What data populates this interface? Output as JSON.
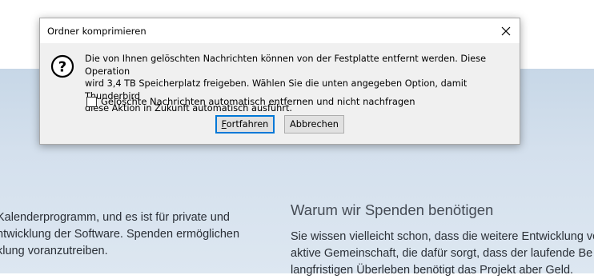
{
  "dialog": {
    "title": "Ordner komprimieren",
    "message_line1": "Die von Ihnen gelöschten Nachrichten können von der Festplatte entfernt werden. Diese Operation",
    "message_line2": "wird 3,4 TB Speicherplatz freigeben. Wählen Sie die unten angegeben Option, damit Thunderbird",
    "message_line3": "diese Aktion in Zukunft automatisch ausführt.",
    "checkbox_label": "Gelöschte Nachrichten automatisch entfernen und nicht nachfragen",
    "checkbox_checked": false,
    "continue_label": "Fortfahren",
    "cancel_label": "Abbrechen",
    "icons": {
      "close": "close-icon",
      "question": "question-icon"
    }
  },
  "background": {
    "left_lines": [
      "Kalenderprogramm, und es ist für private und",
      "ntwicklung der Software. Spenden ermöglichen",
      "klung voranzutreiben."
    ],
    "right_heading": "Warum wir Spenden benötigen",
    "right_lines": [
      "Sie wissen vielleicht schon, dass die weitere Entwicklung vo",
      "aktive Gemeinschaft, die dafür sorgt, dass der laufende Be",
      "langfristigen Überleben benötigt das Projekt aber Geld."
    ]
  },
  "colors": {
    "focus_border": "#0078d7",
    "dialog_bg": "#f0f0f0",
    "page_band": "#cfdcea"
  }
}
